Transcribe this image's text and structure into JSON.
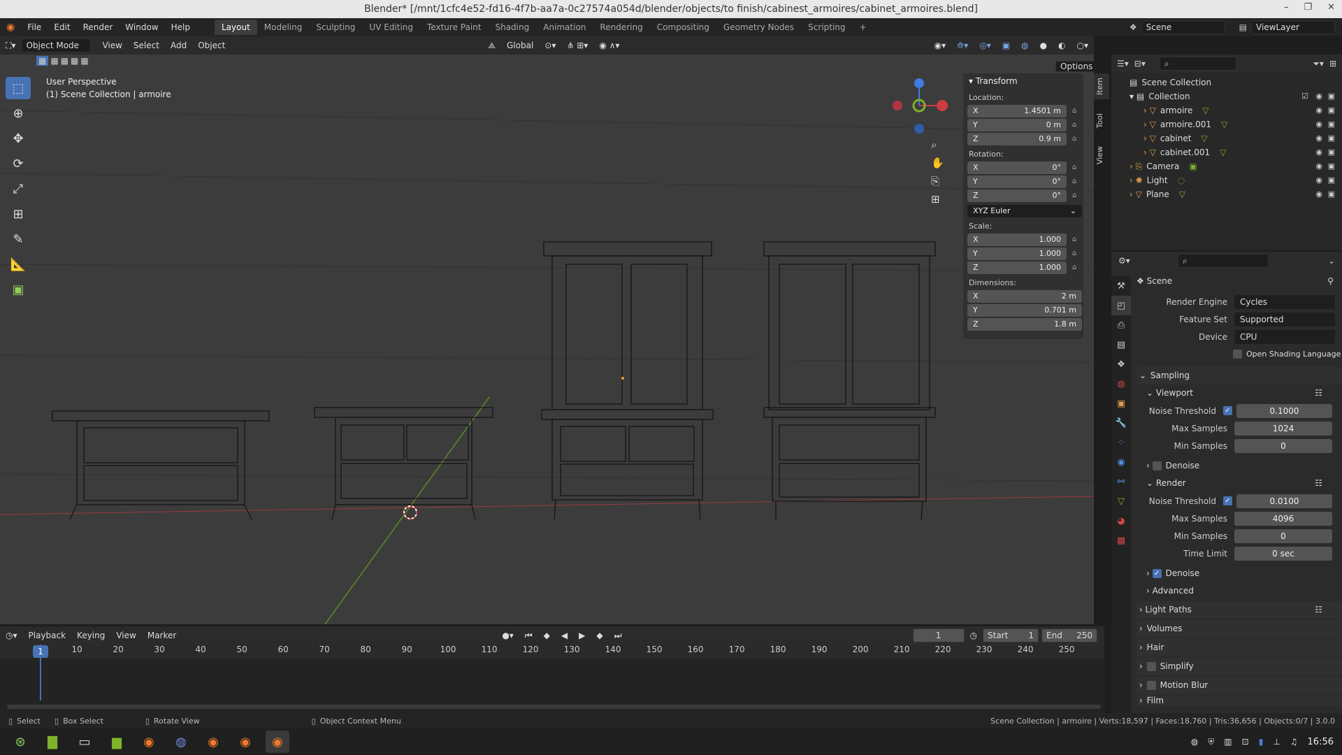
{
  "window": {
    "title": "Blender* [/mnt/1cfc4e52-fd16-4f7b-aa7a-0c27574a054d/blender/objects/to finish/cabinest_armoires/cabinet_armoires.blend]"
  },
  "menu": {
    "items": [
      "File",
      "Edit",
      "Render",
      "Window",
      "Help"
    ]
  },
  "workspaces": [
    "Layout",
    "Modeling",
    "Sculpting",
    "UV Editing",
    "Texture Paint",
    "Shading",
    "Animation",
    "Rendering",
    "Compositing",
    "Geometry Nodes",
    "Scripting",
    "+"
  ],
  "top_right": {
    "scene": "Scene",
    "view_layer": "ViewLayer"
  },
  "viewport_header": {
    "mode": "Object Mode",
    "menus": [
      "View",
      "Select",
      "Add",
      "Object"
    ],
    "orientation": "Global",
    "options": "Options"
  },
  "viewport": {
    "perspective": "User Perspective",
    "collection_info": "(1) Scene Collection | armoire"
  },
  "side_tabs": [
    "Item",
    "Tool",
    "View"
  ],
  "transform": {
    "title": "Transform",
    "location_label": "Location:",
    "location": [
      {
        "axis": "X",
        "value": "1.4501 m"
      },
      {
        "axis": "Y",
        "value": "0 m"
      },
      {
        "axis": "Z",
        "value": "0.9 m"
      }
    ],
    "rotation_label": "Rotation:",
    "rotation": [
      {
        "axis": "X",
        "value": "0°"
      },
      {
        "axis": "Y",
        "value": "0°"
      },
      {
        "axis": "Z",
        "value": "0°"
      }
    ],
    "rotation_mode": "XYZ Euler",
    "scale_label": "Scale:",
    "scale": [
      {
        "axis": "X",
        "value": "1.000"
      },
      {
        "axis": "Y",
        "value": "1.000"
      },
      {
        "axis": "Z",
        "value": "1.000"
      }
    ],
    "dimensions_label": "Dimensions:",
    "dimensions": [
      {
        "axis": "X",
        "value": "2 m"
      },
      {
        "axis": "Y",
        "value": "0.701 m"
      },
      {
        "axis": "Z",
        "value": "1.8 m"
      }
    ]
  },
  "outliner": {
    "root": "Scene Collection",
    "collection": "Collection",
    "children": [
      "armoire",
      "armoire.001",
      "cabinet",
      "cabinet.001"
    ],
    "objects": [
      "Camera",
      "Light",
      "Plane"
    ]
  },
  "properties": {
    "title": "Scene",
    "render_engine_label": "Render Engine",
    "render_engine": "Cycles",
    "feature_set_label": "Feature Set",
    "feature_set": "Supported",
    "device_label": "Device",
    "device": "CPU",
    "osl": "Open Shading Language",
    "sampling": "Sampling",
    "viewport": "Viewport",
    "noise_threshold_label": "Noise Threshold",
    "vp_noise": "0.1000",
    "max_samples_label": "Max Samples",
    "vp_max": "1024",
    "min_samples_label": "Min Samples",
    "vp_min": "0",
    "denoise": "Denoise",
    "render": "Render",
    "r_noise": "0.0100",
    "r_max": "4096",
    "r_min": "0",
    "time_limit_label": "Time Limit",
    "time_limit": "0 sec",
    "advanced": "Advanced",
    "light_paths": "Light Paths",
    "volumes": "Volumes",
    "hair": "Hair",
    "simplify": "Simplify",
    "motion_blur": "Motion Blur",
    "film": "Film"
  },
  "timeline": {
    "menus": [
      "Playback",
      "Keying",
      "View",
      "Marker"
    ],
    "current": "1",
    "start_label": "Start",
    "start": "1",
    "end_label": "End",
    "end": "250",
    "ticks": [
      "1",
      "10",
      "20",
      "30",
      "40",
      "50",
      "60",
      "70",
      "80",
      "90",
      "100",
      "110",
      "120",
      "130",
      "140",
      "150",
      "160",
      "170",
      "180",
      "190",
      "200",
      "210",
      "220",
      "230",
      "240",
      "250"
    ]
  },
  "status": {
    "select": "Select",
    "box_select": "Box Select",
    "rotate": "Rotate View",
    "context": "Object Context Menu",
    "stats": "Scene Collection | armoire | Verts:18,597 | Faces:18,760 | Tris:36,656 | Objects:0/7 | 3.0.0"
  },
  "taskbar": {
    "clock": "16:56"
  },
  "colors": {
    "accent": "#4772b3",
    "x_axis": "#cc3c45",
    "y_axis": "#7fb32a",
    "z_axis": "#3d7ce0"
  }
}
